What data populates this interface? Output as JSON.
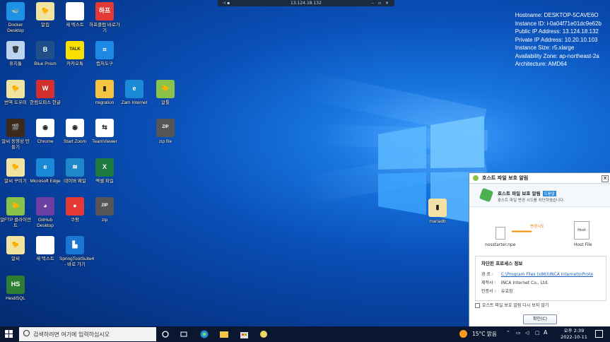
{
  "remote_bar": {
    "title": "13.124.18.132"
  },
  "sysinfo": {
    "hostname": "Hostname: DESKTOP-5CAVE6O",
    "instance_id": "Instance ID: i-0a04f71e01dc9e62b",
    "public_ip": "Public IP Address: 13.124.18.132",
    "private_ip": "Private IP Address: 10.20.10.103",
    "instance_size": "Instance Size: r5.xlarge",
    "availability_zone": "Availability Zone: ap-northeast-2a",
    "architecture": "Architecture: AMD64"
  },
  "desktop_icons": [
    {
      "label": "Docker Desktop",
      "icon": "docker-icon",
      "color": "#1d91e6",
      "glyph": "🐳"
    },
    {
      "label": "휴지통",
      "icon": "recycle-bin-icon",
      "color": "#bcd4ee",
      "glyph": "🗑"
    },
    {
      "label": "번역 도우미",
      "icon": "assistant-icon",
      "color": "#f1e3a0",
      "glyph": "🐤"
    },
    {
      "label": "알씨 동영상 만들기",
      "icon": "video-maker-icon",
      "color": "#3b2a1a",
      "glyph": "🎬"
    },
    {
      "label": "알씨 꾸미기",
      "icon": "alsee-icon",
      "color": "#f1e3a0",
      "glyph": "🐤"
    },
    {
      "label": "알FTP 클라이언트",
      "icon": "alftp-icon",
      "color": "#8bc34a",
      "glyph": "🐤"
    },
    {
      "label": "알씨",
      "icon": "alsee-icon",
      "color": "#f1e3a0",
      "glyph": "🐤"
    },
    {
      "label": "HeidiSQL",
      "icon": "heidisql-icon",
      "color": "#2e7d32",
      "glyph": "HS"
    },
    {
      "label": "알집",
      "icon": "alzip-icon",
      "color": "#f1e3a0",
      "glyph": "🐤"
    },
    {
      "label": "Blue Prism",
      "icon": "blueprism-icon",
      "color": "#1f4f8a",
      "glyph": "B"
    },
    {
      "label": "한컴오피스 한글",
      "icon": "hancom-icon",
      "color": "#d32f2f",
      "glyph": "W"
    },
    {
      "label": "Chrome",
      "icon": "chrome-icon",
      "color": "#ffffff",
      "glyph": "◉"
    },
    {
      "label": "Microsoft Edge",
      "icon": "edge-icon",
      "color": "#1b8ad6",
      "glyph": "e"
    },
    {
      "label": "GitHub Desktop",
      "icon": "github-icon",
      "color": "#6e3fa3",
      "glyph": "◕"
    },
    {
      "label": "새 텍스트",
      "icon": "file-icon",
      "color": "#ffffff",
      "glyph": ""
    },
    {
      "label": "카카오톡",
      "icon": "kakaotalk-icon",
      "color": "#f9e000",
      "glyph": "TALK"
    },
    {
      "label": "Start Zoom",
      "icon": "chrome-icon",
      "color": "#ffffff",
      "glyph": "◉"
    },
    {
      "label": "네이버 웨일",
      "icon": "whale-icon",
      "color": "#1e88c8",
      "glyph": "≋"
    },
    {
      "label": "쿠팡",
      "icon": "coupang-icon",
      "color": "#e53935",
      "glyph": "●"
    },
    {
      "label": "SpringToolSuite4 - 바로 가기",
      "icon": "spring-icon",
      "color": "#1976d2",
      "glyph": "▙"
    },
    {
      "label": "하프클럽 바로가기",
      "icon": "halfclub-icon",
      "color": "#e53935",
      "glyph": "하프"
    },
    {
      "label": "캡처도구",
      "icon": "capture-icon",
      "color": "#1e88e5",
      "glyph": "⌗"
    },
    {
      "label": "migration",
      "icon": "folder-icon",
      "color": "#f5c542",
      "glyph": "▮"
    },
    {
      "label": "TeamViewer",
      "icon": "teamviewer-icon",
      "color": "#ffffff",
      "glyph": "⇆"
    },
    {
      "label": "엑셀 파일",
      "icon": "excel-icon",
      "color": "#1e7a3f",
      "glyph": "X"
    },
    {
      "label": "zip",
      "icon": "zip-icon",
      "color": "#555555",
      "glyph": "ZIP"
    },
    {
      "label": "Zam Internet",
      "icon": "edge-icon",
      "color": "#1b8ad6",
      "glyph": "e"
    },
    {
      "label": "알툴",
      "icon": "altool-icon",
      "color": "#8bc34a",
      "glyph": "🐤"
    },
    {
      "label": "zip file",
      "icon": "zip-icon",
      "color": "#555555",
      "glyph": "ZIP"
    },
    {
      "label": "mariadb",
      "icon": "folder-icon",
      "color": "#f3e1a6",
      "glyph": "▮"
    }
  ],
  "dialog": {
    "title": "호스트 파일 보호 알림",
    "header_title": "호스트 파일 보호 알림",
    "header_badge": "도움말",
    "header_sub": "호스트 파일 변경 시도를 차단하였습니다.",
    "flow_status": "변경시도",
    "flow_arrows": "▸▸▸▸▸▸▸▸▸▸▸▸▸▸",
    "from_label": "nosstarter.npe",
    "to_icon_text": "Host",
    "to_label": "Host File",
    "box_title": "차단된 프로세스 정보",
    "path_key": "경 로 :",
    "path_value": "C:\\Program Files (x86)\\INCA Internet\\nProte",
    "maker_key": "제작사 :",
    "maker_value": "INCA Internet Co., Ltd.",
    "cert_key": "인증서 :",
    "cert_value": "유효함",
    "checkbox_label": "호스트 파일 보호 알림 다시 보지 않기",
    "ok_label": "확인(C)"
  },
  "taskbar": {
    "search_placeholder": "검색하려면 여기에 입력하십시오",
    "weather": "15°C 맑음",
    "time": "오후 2:39",
    "date": "2022-10-11",
    "ime": "A"
  }
}
